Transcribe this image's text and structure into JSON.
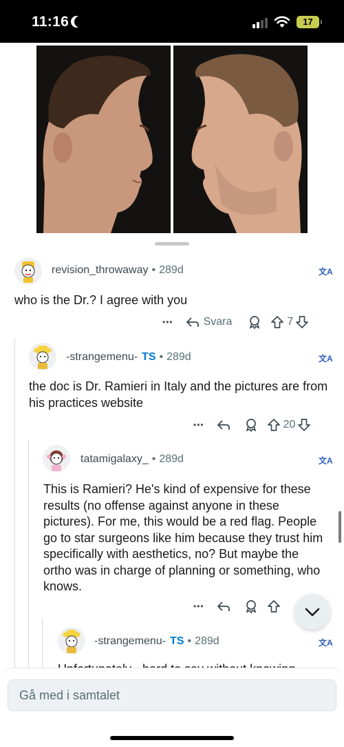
{
  "status": {
    "time": "11:16",
    "battery": "17"
  },
  "comments": [
    {
      "user": "revision_throwaway",
      "age": "289d",
      "body": "who is the Dr.? I agree with you",
      "reply_label": "Svara",
      "score": "7"
    },
    {
      "user": "-strangemenu-",
      "badge": "TS",
      "age": "289d",
      "body": "the doc is Dr. Ramieri in Italy and the pictures are from his practices website",
      "score": "20"
    },
    {
      "user": "tatamigalaxy_",
      "age": "289d",
      "body": "This is Ramieri? He's kind of expensive for these results (no offense against anyone in these pictures). For me, this would be a red flag. People go to star surgeons like him because they trust him specifically with aesthetics, no? But maybe the ortho was in charge of planning or something, who knows."
    },
    {
      "user": "-strangemenu-",
      "badge": "TS",
      "age": "289d",
      "body": "Unfortunately - hard to say without knowing"
    }
  ],
  "dot": "•",
  "more_label": "•••",
  "translate_label": "文A",
  "composer": {
    "placeholder": "Gå med i samtalet"
  },
  "colors": {
    "accent": "#0079d3",
    "meta": "#576f76",
    "thread": "#d5d8da"
  },
  "icons": [
    "moon-icon",
    "signal-icon",
    "wifi-icon",
    "battery-icon",
    "translate-icon",
    "more-icon",
    "reply-icon",
    "award-icon",
    "upvote-icon",
    "downvote-icon",
    "chevron-down-icon"
  ]
}
